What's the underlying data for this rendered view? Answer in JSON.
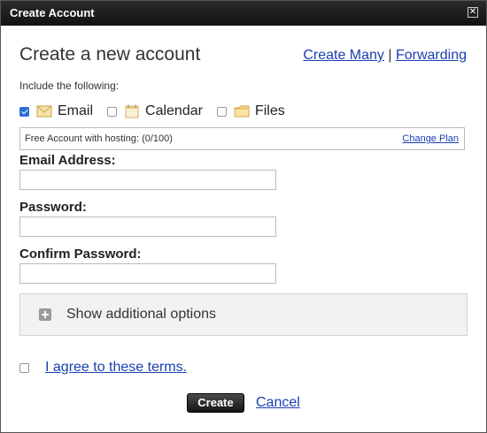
{
  "window": {
    "title": "Create Account",
    "close_glyph": "✕"
  },
  "header": {
    "heading": "Create a new account",
    "link_create_many": "Create Many",
    "separator": "|",
    "link_forwarding": "Forwarding"
  },
  "include": {
    "label": "Include the following:",
    "options": [
      {
        "label": "Email",
        "checked": true,
        "icon": "envelope-icon"
      },
      {
        "label": "Calendar",
        "checked": false,
        "icon": "calendar-icon"
      },
      {
        "label": "Files",
        "checked": false,
        "icon": "folder-icon"
      }
    ]
  },
  "plan": {
    "text": "Free Account with hosting: (0/100)",
    "link": "Change Plan"
  },
  "form": {
    "email_label": "Email Address:",
    "email_value": "",
    "password_label": "Password:",
    "password_value": "",
    "confirm_label": "Confirm Password:",
    "confirm_value": ""
  },
  "more_options": {
    "label": "Show additional options",
    "icon": "plus-icon"
  },
  "terms": {
    "checked": false,
    "link": "I agree to these terms."
  },
  "actions": {
    "create_label": "Create",
    "cancel_label": "Cancel"
  },
  "colors": {
    "link": "#1a3fb2",
    "titlebar": "#1c1c1c",
    "checkbox_checked": "#2b6fd6"
  }
}
